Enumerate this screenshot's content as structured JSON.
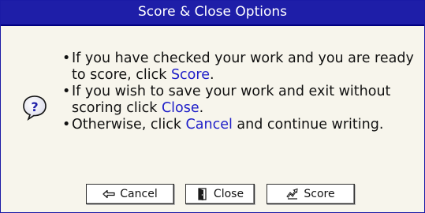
{
  "dialog": {
    "title": "Score & Close Options",
    "icon": "question-icon",
    "messages": [
      {
        "prefix": "If you have checked your work and you are ready to score, click ",
        "keyword": "Score",
        "suffix": "."
      },
      {
        "prefix": "If you wish to save your work and exit without scoring click ",
        "keyword": "Close",
        "suffix": "."
      },
      {
        "prefix": "Otherwise, click ",
        "keyword": "Cancel",
        "suffix": " and continue writing."
      }
    ],
    "buttons": {
      "cancel": {
        "label": "Cancel",
        "icon": "arrow-left-icon"
      },
      "close": {
        "label": "Close",
        "icon": "door-icon"
      },
      "score": {
        "label": "Score",
        "icon": "submit-arrow-icon"
      }
    }
  },
  "colors": {
    "title_bar": "#1e1ea8",
    "dialog_background": "#f7f5ec",
    "keyword": "#1d1dc8"
  }
}
